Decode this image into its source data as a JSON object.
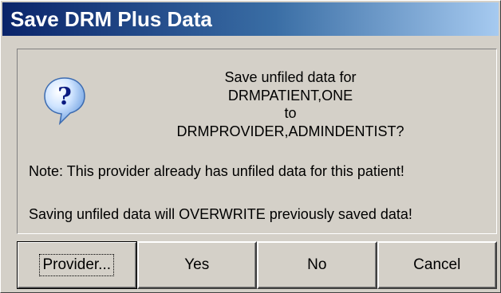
{
  "window": {
    "title": "Save DRM Plus Data"
  },
  "dialog": {
    "icon": "question-icon",
    "message_lines": [
      "Save unfiled data for",
      "DRMPATIENT,ONE",
      "to",
      "DRMPROVIDER,ADMINDENTIST?"
    ],
    "note": "Note: This provider already has unfiled data for this patient!",
    "warning": "Saving unfiled data will OVERWRITE previously saved data!"
  },
  "buttons": {
    "provider": "Provider...",
    "yes": "Yes",
    "no": "No",
    "cancel": "Cancel"
  },
  "colors": {
    "title_gradient_start": "#0a246a",
    "title_gradient_end": "#a6caf0",
    "face": "#d4d0c8"
  }
}
